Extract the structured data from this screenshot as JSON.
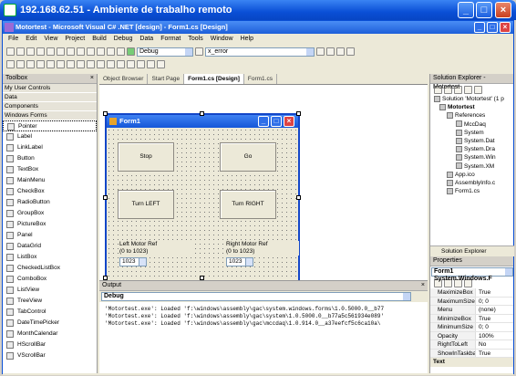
{
  "remote": {
    "title": "192.168.62.51 - Ambiente de trabalho remoto"
  },
  "vs": {
    "title": "Motortest - Microsoft Visual C# .NET [design] - Form1.cs [Design]",
    "menu": [
      "File",
      "Edit",
      "View",
      "Project",
      "Build",
      "Debug",
      "Data",
      "Format",
      "Tools",
      "Window",
      "Help"
    ],
    "config_combo": "Debug",
    "find_combo": "x_error"
  },
  "toolbox": {
    "title": "Toolbox",
    "categories": [
      "My User Controls",
      "Data",
      "Components",
      "Windows Forms"
    ],
    "items": [
      "Pointer",
      "Label",
      "LinkLabel",
      "Button",
      "TextBox",
      "MainMenu",
      "CheckBox",
      "RadioButton",
      "GroupBox",
      "PictureBox",
      "Panel",
      "DataGrid",
      "ListBox",
      "CheckedListBox",
      "ComboBox",
      "ListView",
      "TreeView",
      "TabControl",
      "DateTimePicker",
      "MonthCalendar",
      "HScrollBar",
      "VScrollBar"
    ]
  },
  "tabs": [
    "Object Browser",
    "Start Page",
    "Form1.cs [Design]",
    "Form1.cs"
  ],
  "form": {
    "title": "Form1",
    "buttons": {
      "stop": "Stop",
      "go": "Go",
      "left": "Turn LEFT",
      "right": "Turn RIGHT"
    },
    "left_label_1": "Left Motor Ref",
    "left_label_2": "(0 to 1023)",
    "right_label_1": "Right Motor Ref",
    "right_label_2": "(0 to 1023)",
    "left_value": "1023",
    "right_value": "1023"
  },
  "output": {
    "title": "Output",
    "combo": "Debug",
    "lines": [
      "'Motortest.exe': Loaded 'f:\\windows\\assembly\\gac\\system.windows.forms\\1.0.5000.0__b77",
      "'Motortest.exe': Loaded 'f:\\windows\\assembly\\gac\\system\\1.0.5000.0__b77a5c561934e089'",
      "'Motortest.exe': Loaded 'f:\\windows\\assembly\\gac\\mccdaq\\1.0.914.0__a37eefcf5c6ca10a\\"
    ]
  },
  "solution": {
    "title": "Solution Explorer - Motortest",
    "tree": [
      "Solution 'Motortest' (1 p",
      "Motortest",
      "References",
      "MccDaq",
      "System",
      "System.Dat",
      "System.Dra",
      "System.Win",
      "System.XM",
      "App.ico",
      "AssemblyInfo.c",
      "Form1.cs"
    ],
    "bottom_tab": "Solution Explorer"
  },
  "properties": {
    "title": "Properties",
    "object": "Form1  System.Windows.F",
    "rows": [
      [
        "MaximizeBox",
        "True"
      ],
      [
        "MaximumSize",
        "0; 0"
      ],
      [
        "Menu",
        "(none)"
      ],
      [
        "MinimizeBox",
        "True"
      ],
      [
        "MinimumSize",
        "0; 0"
      ],
      [
        "Opacity",
        "100%"
      ],
      [
        "RightToLeft",
        "No"
      ],
      [
        "ShowInTaskbar",
        "True"
      ]
    ],
    "footer": "Text"
  }
}
